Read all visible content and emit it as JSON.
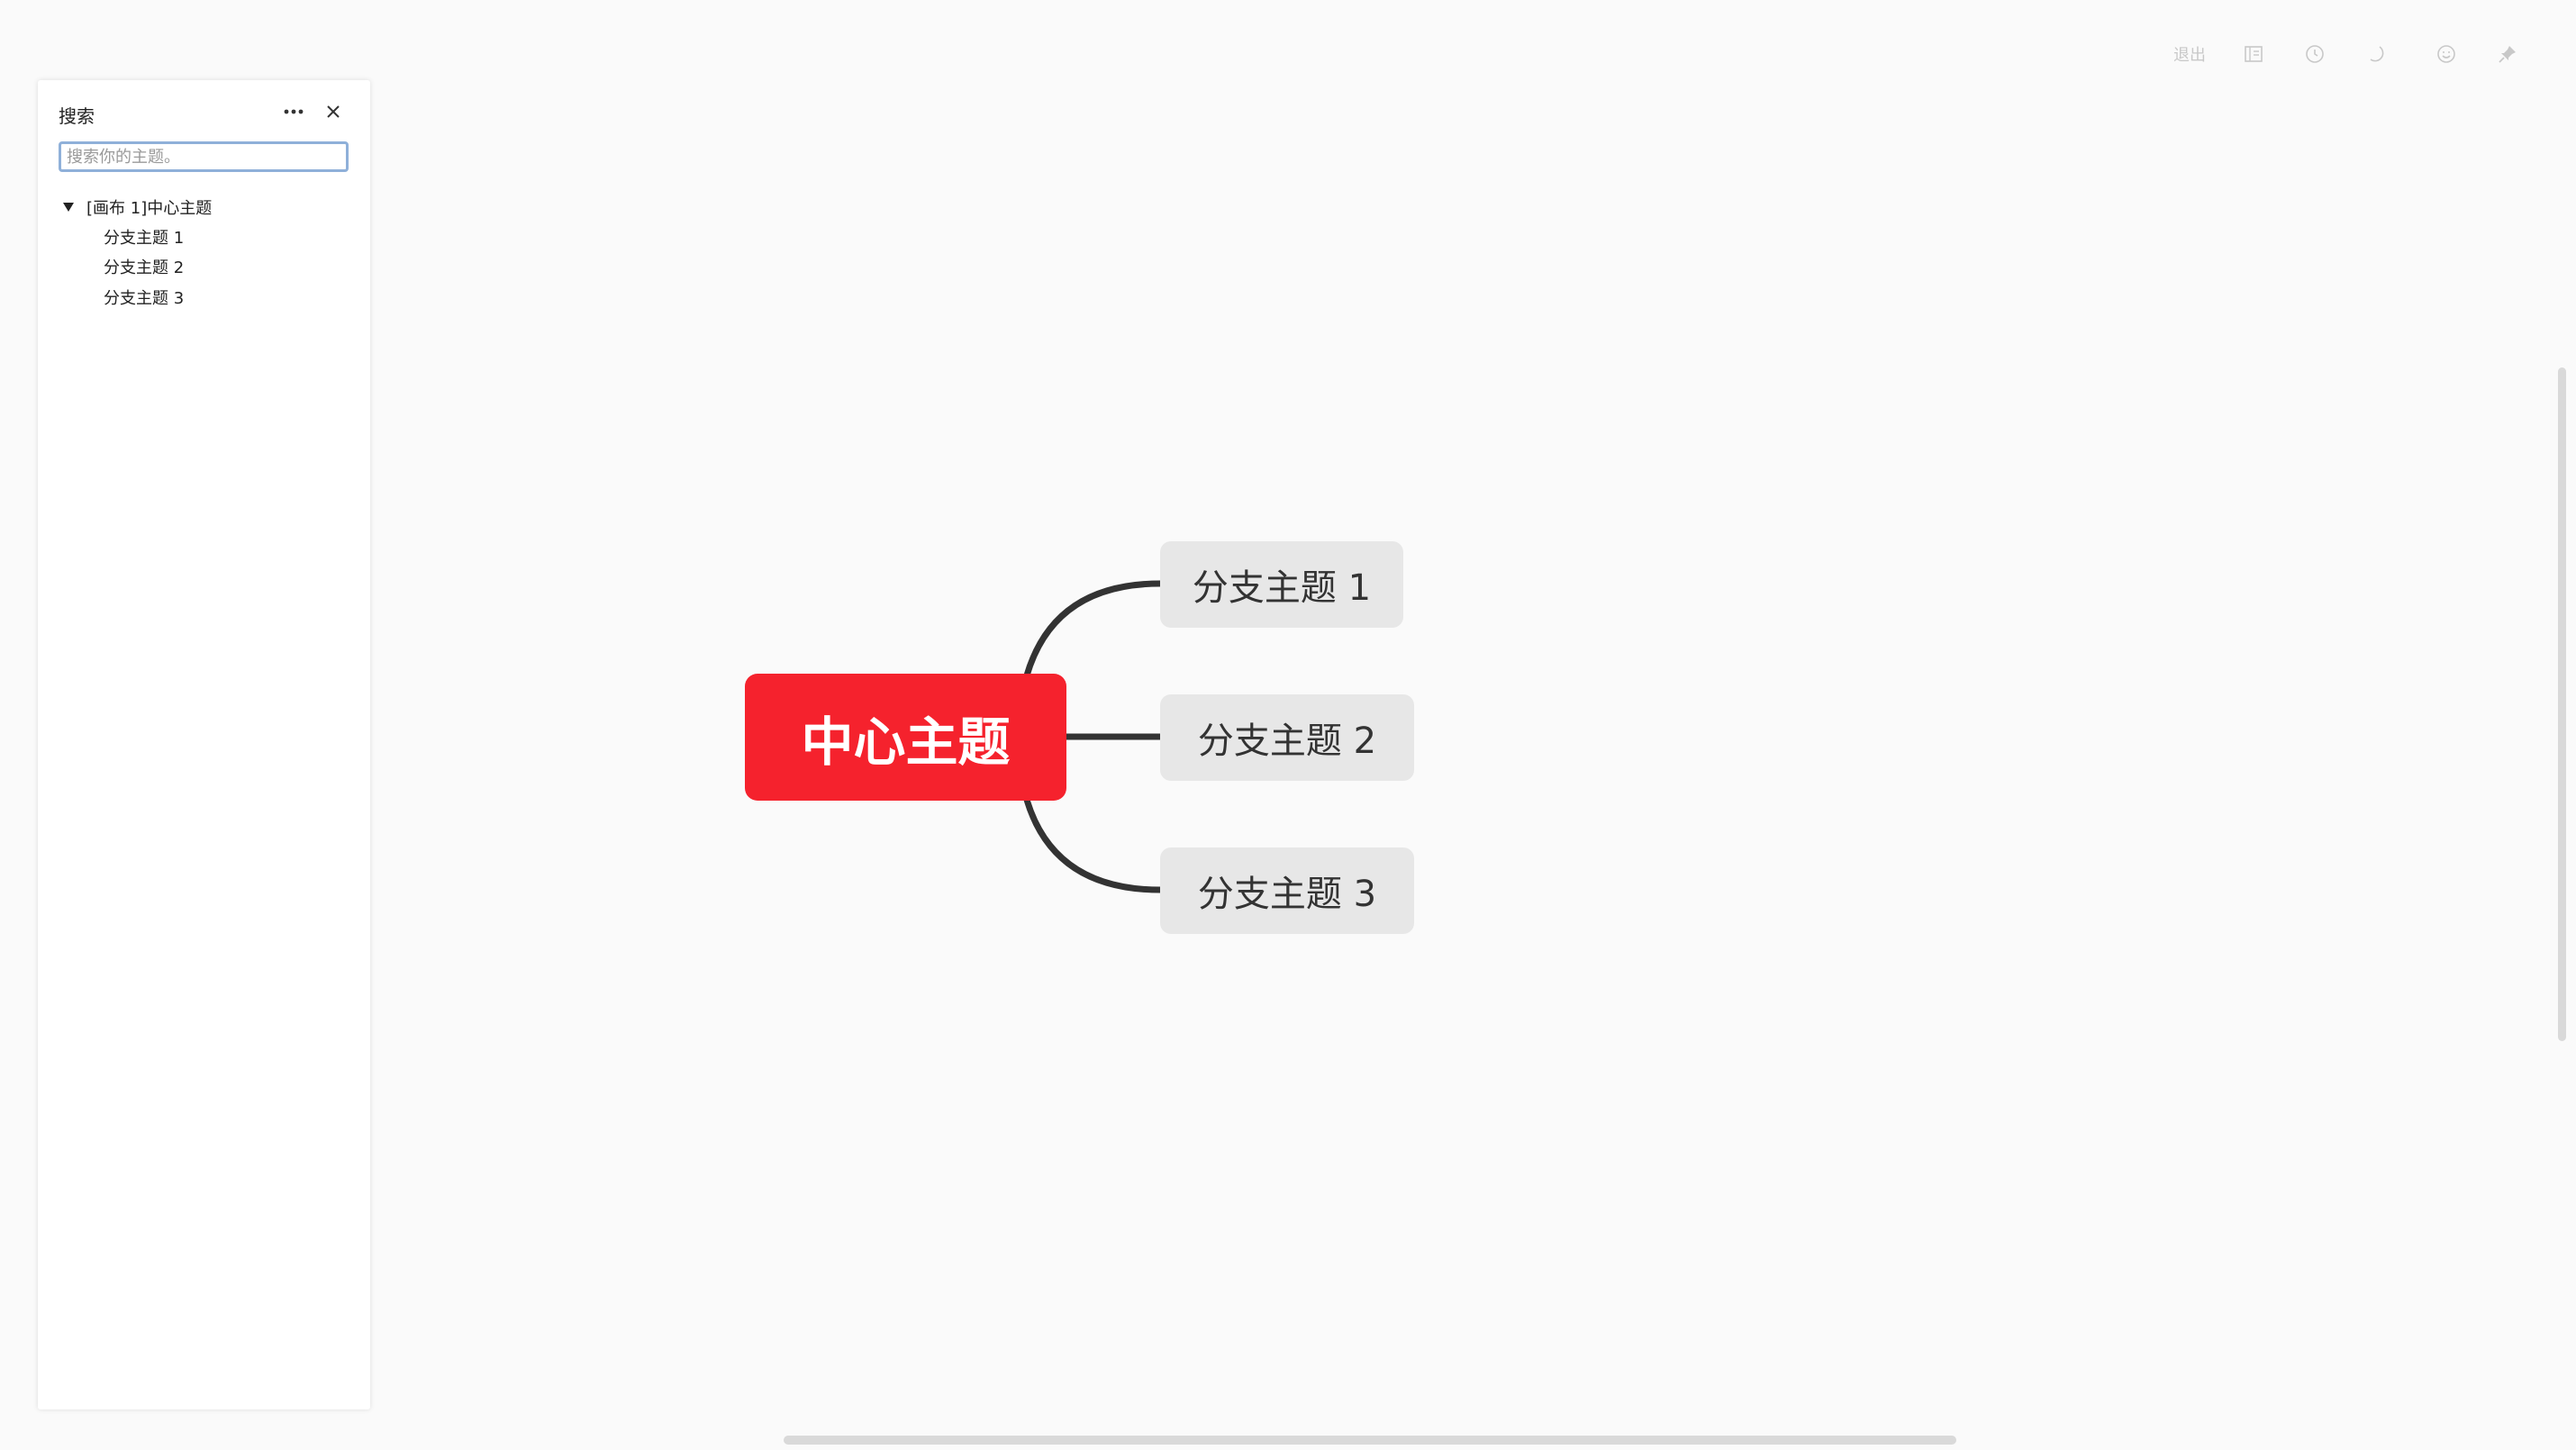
{
  "toolbar": {
    "exit_label": "退出",
    "icons": [
      "outline-view-icon",
      "clock-icon",
      "moon-icon",
      "emoji-icon",
      "pin-icon"
    ]
  },
  "search_panel": {
    "title": "搜索",
    "more_icon": "more-dots-icon",
    "close_icon": "close-icon",
    "search_placeholder": "搜索你的主题。",
    "search_value": "",
    "tree": {
      "root_label": "[画布 1]中心主题",
      "children": [
        "分支主题 1",
        "分支主题 2",
        "分支主题 3"
      ]
    }
  },
  "mindmap": {
    "central_topic": "中心主题",
    "subtopics": [
      "分支主题 1",
      "分支主题 2",
      "分支主题 3"
    ],
    "colors": {
      "central_bg": "#f5222d",
      "subtopic_bg": "#e7e7e7",
      "connector": "#333333"
    }
  }
}
